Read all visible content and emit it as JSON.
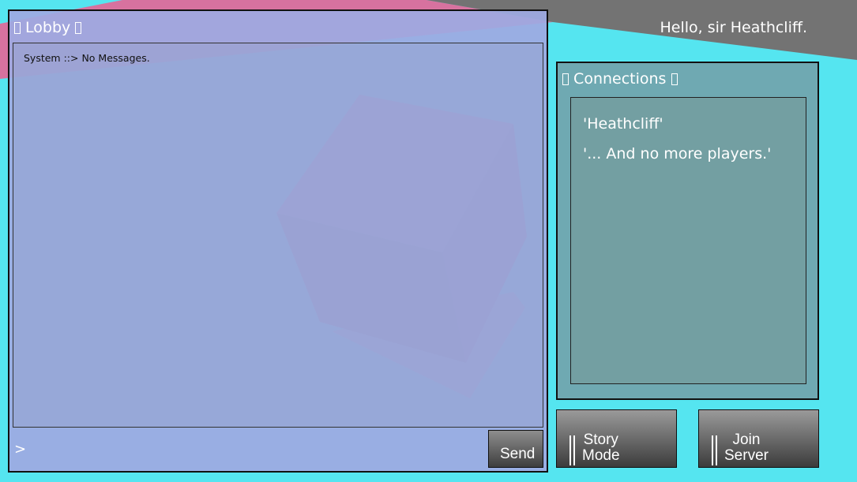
{
  "lobby": {
    "title": "Lobby",
    "messages": [
      "System ::> No Messages."
    ],
    "input_value": ">",
    "send_label": "Send"
  },
  "greeting": "Hello, sir Heathcliff.",
  "connections": {
    "title": "Connections",
    "players": [
      "'Heathcliff'",
      "'... And no more players.'"
    ]
  },
  "menu": {
    "story_mode_label": "Story\nMode",
    "join_server_label": "Join\nServer"
  },
  "colors": {
    "sky": "#55e5f0",
    "ground": "#737373",
    "cube_top": "#b07cb6",
    "cube_left": "#8e6190",
    "cube_right": "#9a699d",
    "lobby_panel": "#9eaae2",
    "connections_panel": "#6fa9b2"
  }
}
